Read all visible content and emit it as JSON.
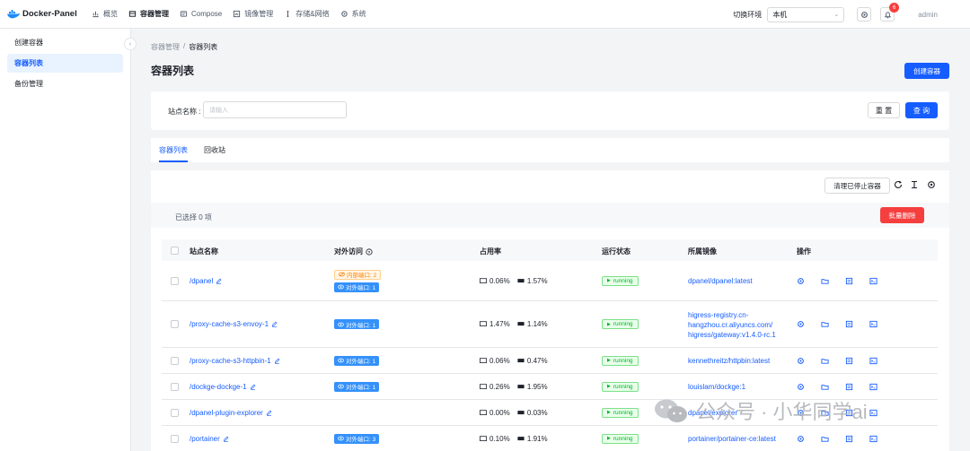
{
  "app": {
    "name": "Docker-Panel"
  },
  "nav": [
    {
      "label": "概览",
      "icon": "chart-icon"
    },
    {
      "label": "容器管理",
      "icon": "container-icon",
      "active": true
    },
    {
      "label": "Compose",
      "icon": "compose-icon"
    },
    {
      "label": "镜像管理",
      "icon": "image-icon"
    },
    {
      "label": "存储&网络",
      "icon": "storage-icon"
    },
    {
      "label": "系统",
      "icon": "gear-icon"
    }
  ],
  "header": {
    "env_label": "切换环境",
    "env_value": "本机",
    "notification_count": "6",
    "user": "admin"
  },
  "sidebar": {
    "items": [
      {
        "label": "创建容器"
      },
      {
        "label": "容器列表",
        "active": true
      },
      {
        "label": "备份管理"
      }
    ]
  },
  "breadcrumb": {
    "parent": "容器管理",
    "separator": "/",
    "current": "容器列表"
  },
  "page": {
    "title": "容器列表",
    "create_label": "创建容器"
  },
  "search": {
    "label": "站点名称 :",
    "placeholder": "请输入",
    "reset_label": "重 置",
    "query_label": "查 询"
  },
  "tabs": [
    {
      "label": "容器列表",
      "active": true
    },
    {
      "label": "回收站"
    }
  ],
  "toolbar": {
    "clean_label": "清理已停止容器"
  },
  "selection": {
    "text": "已选择  0  项",
    "bulk_delete_label": "批量删除"
  },
  "table": {
    "columns": {
      "name": "站点名称",
      "access": "对外访问",
      "usage": "占用率",
      "status": "运行状态",
      "image": "所属镜像",
      "ops": "操作"
    },
    "rows": [
      {
        "name": "/dpanel",
        "internal": "内部端口: 2",
        "external": "对外端口: 1",
        "cpu": "0.06%",
        "mem": "1.57%",
        "status": "running",
        "image": [
          "dpanel/dpanel:latest"
        ]
      },
      {
        "name": "/proxy-cache-s3-envoy-1",
        "internal": "",
        "external": "对外端口: 1",
        "cpu": "1.47%",
        "mem": "1.14%",
        "status": "running",
        "image": [
          "higress-registry.cn-",
          "hangzhou.cr.aliyuncs.com/",
          "higress/gateway:v1.4.0-rc.1"
        ]
      },
      {
        "name": "/proxy-cache-s3-httpbin-1",
        "internal": "",
        "external": "对外端口: 1",
        "cpu": "0.06%",
        "mem": "0.47%",
        "status": "running",
        "image": [
          "kennethreitz/httpbin:latest"
        ]
      },
      {
        "name": "/dockge-dockge-1",
        "internal": "",
        "external": "对外端口: 1",
        "cpu": "0.26%",
        "mem": "1.95%",
        "status": "running",
        "image": [
          "louislam/dockge:1"
        ]
      },
      {
        "name": "/dpanel-plugin-explorer",
        "internal": "",
        "external": "",
        "cpu": "0.00%",
        "mem": "0.03%",
        "status": "running",
        "image": [
          "dpanel/explorer"
        ]
      },
      {
        "name": "/portainer",
        "internal": "",
        "external": "对外端口: 3",
        "cpu": "0.10%",
        "mem": "1.91%",
        "status": "running",
        "image": [
          "portainer/portainer-ce:latest"
        ]
      }
    ]
  },
  "watermark": {
    "text": "公众号 · 小华同学ai"
  },
  "colors": {
    "primary": "#165dff",
    "danger": "#f53f3f",
    "success": "#00b42a",
    "tag": "#3491fa"
  }
}
